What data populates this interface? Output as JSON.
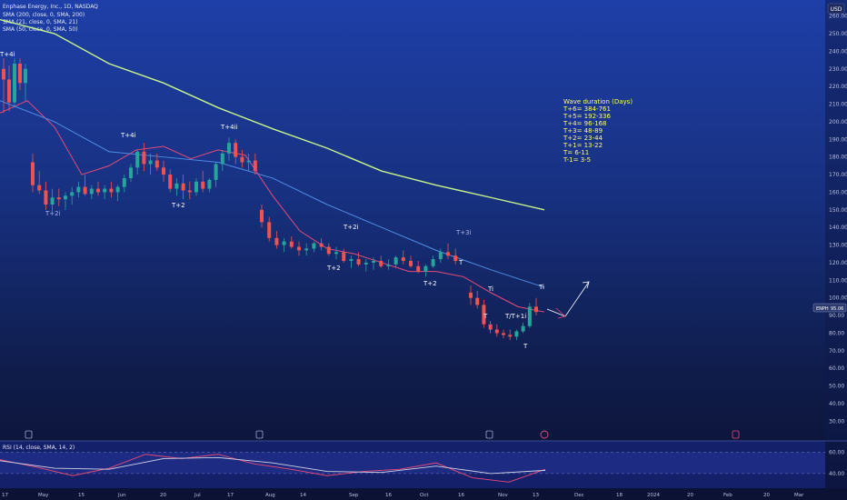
{
  "header": {
    "symbol_line": "Enphase Energy, Inc., 1D, NASDAQ",
    "sma200_line": "SMA (200, close, 0, SMA, 200)",
    "sma21_line": "SMA (21, close, 0, SMA, 21)",
    "sma50_line": "SMA (50, close, 0, SMA, 50)",
    "currency": "USD"
  },
  "price_tag": {
    "symbol": "ENPH",
    "value": "95.06"
  },
  "rsi_header": "RSI (14, close, SMA, 14, 2)",
  "colors": {
    "bull": "#26a69a",
    "bear": "#ef5350",
    "sma200": "#c6f58a",
    "sma21": "#e84a7a",
    "sma50": "#4f8de0",
    "rsi": "#e84a7a",
    "rsi_ma": "#d0d4e8"
  },
  "chart_data": [
    {
      "type": "candlestick",
      "title": "Enphase Energy, Inc., 1D, NASDAQ",
      "ylim": [
        25,
        265
      ],
      "y_ticks": [
        "260.00",
        "250.00",
        "240.00",
        "230.00",
        "220.00",
        "210.00",
        "200.00",
        "190.00",
        "180.00",
        "170.00",
        "160.00",
        "150.00",
        "140.00",
        "130.00",
        "120.00",
        "110.00",
        "100.00",
        "90.00",
        "80.00",
        "70.00",
        "60.00",
        "50.00",
        "40.00",
        "30.00"
      ],
      "x_tick_labels": [
        "17",
        "May",
        "15",
        "Jun",
        "20",
        "Jul",
        "17",
        "Aug",
        "14",
        "Sep",
        "16",
        "Oct",
        "16",
        "Nov",
        "13",
        "Dec",
        "18",
        "2024",
        "20",
        "Feb",
        "20",
        "Mar"
      ],
      "ohlc": [
        [
          230,
          236,
          205,
          224
        ],
        [
          224,
          232,
          206,
          211
        ],
        [
          211,
          236,
          208,
          233
        ],
        [
          233,
          236,
          218,
          222
        ],
        [
          222,
          233,
          212,
          230
        ],
        [
          177,
          182,
          160,
          164
        ],
        [
          164,
          172,
          159,
          161
        ],
        [
          161,
          166,
          150,
          153
        ],
        [
          153,
          162,
          149,
          157
        ],
        [
          157,
          162,
          152,
          156
        ],
        [
          156,
          160,
          150,
          158
        ],
        [
          158,
          163,
          153,
          160
        ],
        [
          160,
          166,
          157,
          163
        ],
        [
          163,
          170,
          158,
          159
        ],
        [
          159,
          164,
          156,
          162
        ],
        [
          162,
          166,
          158,
          160
        ],
        [
          160,
          164,
          156,
          162
        ],
        [
          162,
          166,
          157,
          160
        ],
        [
          160,
          164,
          155,
          163
        ],
        [
          163,
          170,
          160,
          168
        ],
        [
          168,
          176,
          166,
          174
        ],
        [
          174,
          184,
          170,
          183
        ],
        [
          183,
          188,
          172,
          176
        ],
        [
          176,
          182,
          170,
          178
        ],
        [
          178,
          182,
          172,
          174
        ],
        [
          174,
          178,
          166,
          170
        ],
        [
          170,
          173,
          160,
          162
        ],
        [
          162,
          168,
          158,
          165
        ],
        [
          165,
          170,
          156,
          161
        ],
        [
          161,
          166,
          156,
          160
        ],
        [
          160,
          168,
          158,
          166
        ],
        [
          166,
          172,
          160,
          162
        ],
        [
          162,
          168,
          160,
          167
        ],
        [
          167,
          177,
          163,
          176
        ],
        [
          176,
          184,
          172,
          182
        ],
        [
          182,
          191,
          178,
          188
        ],
        [
          188,
          190,
          176,
          180
        ],
        [
          180,
          184,
          174,
          177
        ],
        [
          177,
          182,
          172,
          178
        ],
        [
          178,
          182,
          170,
          172
        ],
        [
          150,
          153,
          140,
          143
        ],
        [
          143,
          146,
          132,
          134
        ],
        [
          134,
          138,
          128,
          130
        ],
        [
          130,
          134,
          126,
          132
        ],
        [
          132,
          135,
          128,
          129
        ],
        [
          129,
          132,
          124,
          127
        ],
        [
          127,
          131,
          124,
          128
        ],
        [
          128,
          132,
          126,
          131
        ],
        [
          131,
          134,
          127,
          129
        ],
        [
          129,
          131,
          124,
          125
        ],
        [
          125,
          129,
          122,
          126
        ],
        [
          126,
          128,
          120,
          121
        ],
        [
          121,
          124,
          117,
          122
        ],
        [
          122,
          126,
          118,
          119
        ],
        [
          119,
          122,
          115,
          120
        ],
        [
          120,
          123,
          116,
          121
        ],
        [
          121,
          124,
          117,
          118
        ],
        [
          118,
          122,
          116,
          119
        ],
        [
          119,
          124,
          117,
          123
        ],
        [
          123,
          127,
          119,
          121
        ],
        [
          121,
          124,
          117,
          118
        ],
        [
          118,
          121,
          114,
          115
        ],
        [
          115,
          119,
          112,
          118
        ],
        [
          118,
          124,
          117,
          122
        ],
        [
          122,
          128,
          120,
          126
        ],
        [
          126,
          131,
          122,
          124
        ],
        [
          124,
          128,
          119,
          121
        ],
        [
          103,
          107,
          96,
          100
        ],
        [
          100,
          104,
          94,
          96
        ],
        [
          96,
          99,
          83,
          85
        ],
        [
          85,
          87,
          80,
          82
        ],
        [
          82,
          85,
          78,
          80
        ],
        [
          80,
          82,
          77,
          79
        ],
        [
          79,
          82,
          76,
          78
        ],
        [
          78,
          82,
          76,
          81
        ],
        [
          81,
          86,
          80,
          84
        ],
        [
          84,
          97,
          83,
          95
        ],
        [
          95,
          100,
          90,
          92
        ]
      ],
      "series": [
        {
          "name": "SMA (200, close, 0, SMA, 200)",
          "points": [
            [
              0,
              258
            ],
            [
              60,
              250
            ],
            [
              120,
              233
            ],
            [
              180,
              222
            ],
            [
              240,
              208
            ],
            [
              300,
              196
            ],
            [
              360,
              185
            ],
            [
              420,
              172
            ],
            [
              480,
              164
            ],
            [
              540,
              157
            ],
            [
              599,
              150
            ]
          ]
        },
        {
          "name": "SMA (21, close, 0, SMA, 21)",
          "points": [
            [
              0,
              205
            ],
            [
              30,
              212
            ],
            [
              60,
              197
            ],
            [
              90,
              170
            ],
            [
              120,
              175
            ],
            [
              150,
              184
            ],
            [
              180,
              186
            ],
            [
              210,
              179
            ],
            [
              240,
              184
            ],
            [
              270,
              181
            ],
            [
              300,
              158
            ],
            [
              330,
              138
            ],
            [
              360,
              128
            ],
            [
              390,
              125
            ],
            [
              420,
              120
            ],
            [
              450,
              115
            ],
            [
              480,
              115
            ],
            [
              510,
              112
            ],
            [
              540,
              103
            ],
            [
              570,
              95
            ],
            [
              599,
              92
            ]
          ]
        },
        {
          "name": "SMA (50, close, 0, SMA, 50)",
          "points": [
            [
              0,
              212
            ],
            [
              60,
              200
            ],
            [
              120,
              183
            ],
            [
              180,
              180
            ],
            [
              240,
              177
            ],
            [
              300,
              168
            ],
            [
              360,
              153
            ],
            [
              420,
              140
            ],
            [
              480,
              127
            ],
            [
              540,
              116
            ],
            [
              599,
              106
            ]
          ]
        }
      ],
      "annotations": {
        "wave_labels": [
          "T+4i",
          "T+2i",
          "T+4i",
          "T+4ii",
          "T+2",
          "T+2i",
          "T+2",
          "T+3i",
          "T",
          "T+2",
          "Ti",
          "T",
          "T/T+1i",
          "T",
          "Ti"
        ],
        "note_title": "Wave duration (Days)",
        "note_lines": [
          "T+6= 384-761",
          "T+5= 192-336",
          "T+4= 96-168",
          "T+3= 48-89",
          "T+2= 23-44",
          "T+1= 13-22",
          "T= 6-11",
          "T-1= 3-5"
        ]
      }
    },
    {
      "type": "line",
      "title": "RSI (14, close, SMA, 14, 2)",
      "ylim": [
        28,
        68
      ],
      "y_ticks": [
        "60.00",
        "40.00"
      ],
      "series": [
        {
          "name": "RSI",
          "points": [
            [
              0,
              53
            ],
            [
              40,
              46
            ],
            [
              80,
              38
            ],
            [
              120,
              45
            ],
            [
              160,
              58
            ],
            [
              200,
              54
            ],
            [
              240,
              58
            ],
            [
              280,
              49
            ],
            [
              320,
              44
            ],
            [
              360,
              38
            ],
            [
              400,
              42
            ],
            [
              440,
              44
            ],
            [
              480,
              50
            ],
            [
              520,
              36
            ],
            [
              560,
              32
            ],
            [
              600,
              44
            ]
          ]
        },
        {
          "name": "RSI-SMA",
          "points": [
            [
              0,
              52
            ],
            [
              60,
              45
            ],
            [
              120,
              44
            ],
            [
              180,
              54
            ],
            [
              240,
              55
            ],
            [
              300,
              50
            ],
            [
              360,
              42
            ],
            [
              420,
              41
            ],
            [
              480,
              47
            ],
            [
              540,
              40
            ],
            [
              600,
              43
            ]
          ]
        }
      ]
    }
  ]
}
